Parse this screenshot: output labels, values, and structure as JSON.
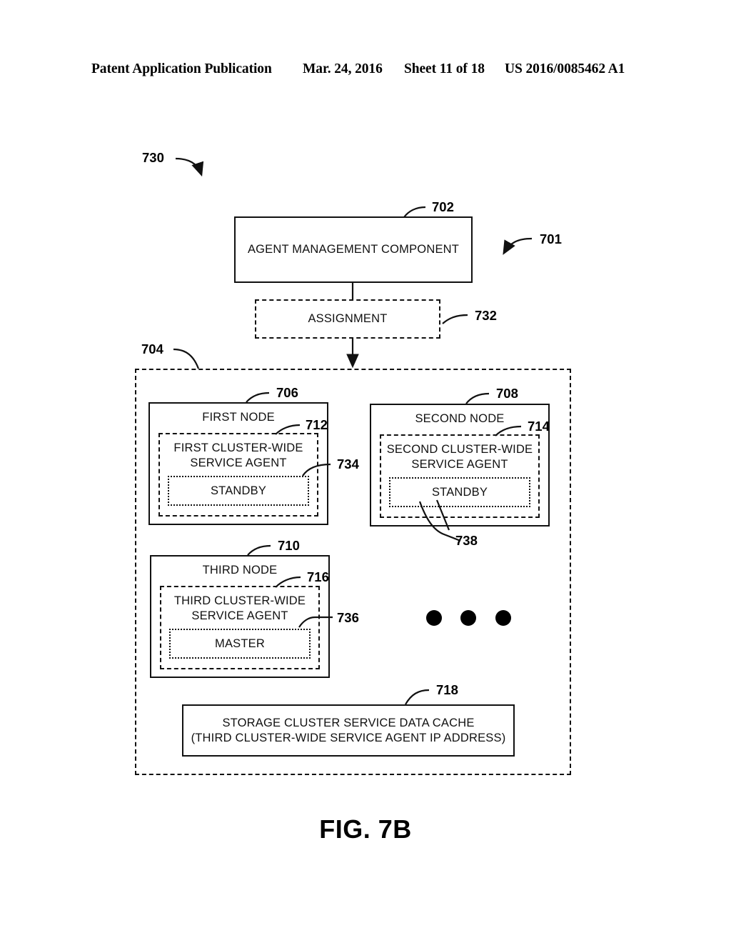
{
  "header": {
    "publication": "Patent Application Publication",
    "date": "Mar. 24, 2016",
    "sheet": "Sheet 11 of 18",
    "number": "US 2016/0085462 A1"
  },
  "figure": {
    "caption": "FIG. 7B"
  },
  "diagram": {
    "system_ref": "730",
    "management_ref": "701",
    "agent_management_component": {
      "label": "AGENT MANAGEMENT COMPONENT",
      "ref": "702"
    },
    "assignment": {
      "label": "ASSIGNMENT",
      "ref": "732"
    },
    "cluster": {
      "ref": "704"
    },
    "nodes": [
      {
        "title": "FIRST NODE",
        "ref": "706",
        "agent_label": "FIRST CLUSTER-WIDE\nSERVICE AGENT",
        "agent_ref": "712",
        "state": "STANDBY",
        "state_ref": "734"
      },
      {
        "title": "SECOND NODE",
        "ref": "708",
        "agent_label": "SECOND CLUSTER-WIDE\nSERVICE AGENT",
        "agent_ref": "714",
        "state": "STANDBY",
        "state_ref": "738"
      },
      {
        "title": "THIRD NODE",
        "ref": "710",
        "agent_label": "THIRD CLUSTER-WIDE\nSERVICE AGENT",
        "agent_ref": "716",
        "state": "MASTER",
        "state_ref": "736"
      }
    ],
    "data_cache": {
      "label": "STORAGE CLUSTER SERVICE DATA CACHE\n(THIRD CLUSTER-WIDE SERVICE AGENT IP ADDRESS)",
      "ref": "718"
    },
    "ellipsis": "three-dots"
  }
}
